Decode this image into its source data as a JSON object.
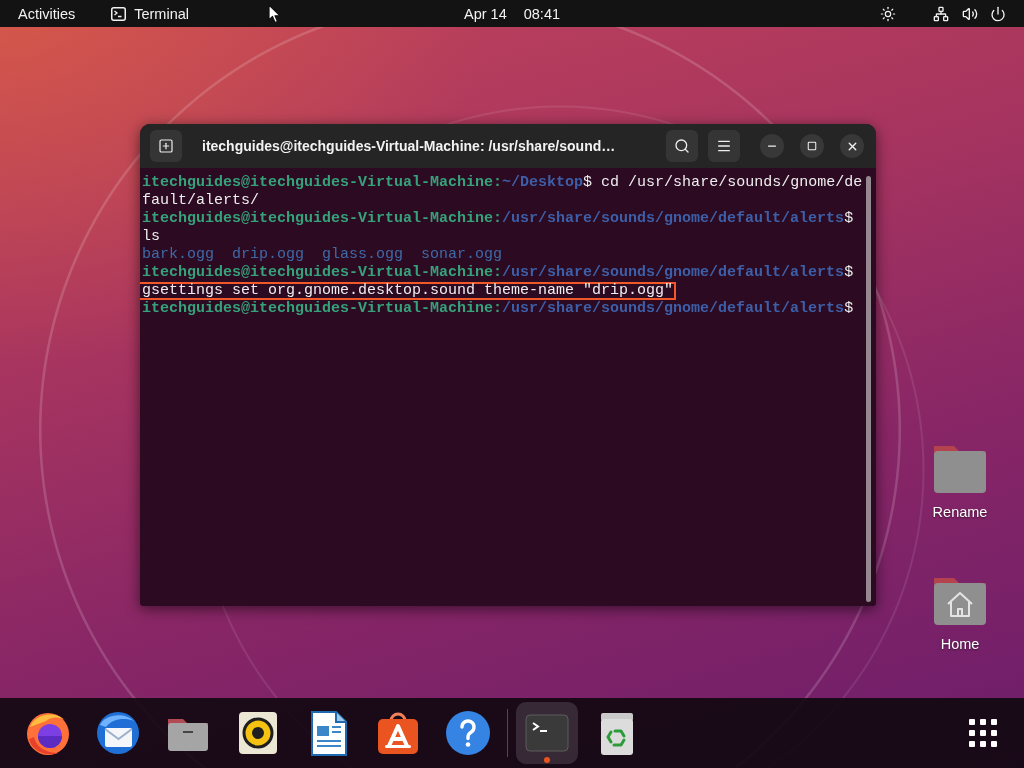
{
  "top_bar": {
    "activities": "Activities",
    "app_menu": "Terminal",
    "date": "Apr 14",
    "time": "08:41"
  },
  "terminal": {
    "title": "itechguides@itechguides-Virtual-Machine: /usr/share/sound…",
    "lines": [
      {
        "kind": "prompt",
        "user": "itechguides@itechguides-Virtual-Machine:",
        "path": "~/Desktop",
        "symbol": "$",
        "command": "cd /usr/share/sounds/gnome/default/alerts/",
        "highlighted": false
      },
      {
        "kind": "prompt",
        "user": "itechguides@itechguides-Virtual-Machine:",
        "path": "/usr/share/sounds/gnome/default/alerts",
        "symbol": "$",
        "command": "ls",
        "highlighted": false
      },
      {
        "kind": "output",
        "files": [
          "bark.ogg",
          "drip.ogg",
          "glass.ogg",
          "sonar.ogg"
        ]
      },
      {
        "kind": "prompt",
        "user": "itechguides@itechguides-Virtual-Machine:",
        "path": "/usr/share/sounds/gnome/default/alerts",
        "symbol": "$",
        "command": "gsettings set org.gnome.desktop.sound theme-name \"drip.ogg\"",
        "highlighted": true
      },
      {
        "kind": "prompt",
        "user": "itechguides@itechguides-Virtual-Machine:",
        "path": "/usr/share/sounds/gnome/default/alerts",
        "symbol": "$"
      }
    ]
  },
  "desktop_icons": [
    {
      "kind": "folder",
      "label": "Rename"
    },
    {
      "kind": "home",
      "label": "Home"
    }
  ],
  "dock": {
    "favorites": [
      {
        "kind": "browser",
        "running": false,
        "selected": false
      },
      {
        "kind": "mail",
        "running": false,
        "selected": false
      },
      {
        "kind": "files",
        "running": false,
        "selected": false
      },
      {
        "kind": "music",
        "running": false,
        "selected": false
      },
      {
        "kind": "writer",
        "running": false,
        "selected": false
      },
      {
        "kind": "store",
        "running": false,
        "selected": false
      },
      {
        "kind": "help",
        "running": false,
        "selected": false
      }
    ],
    "others": [
      {
        "kind": "terminal",
        "running": true,
        "selected": true
      },
      {
        "kind": "trash",
        "running": false,
        "selected": false
      }
    ]
  }
}
